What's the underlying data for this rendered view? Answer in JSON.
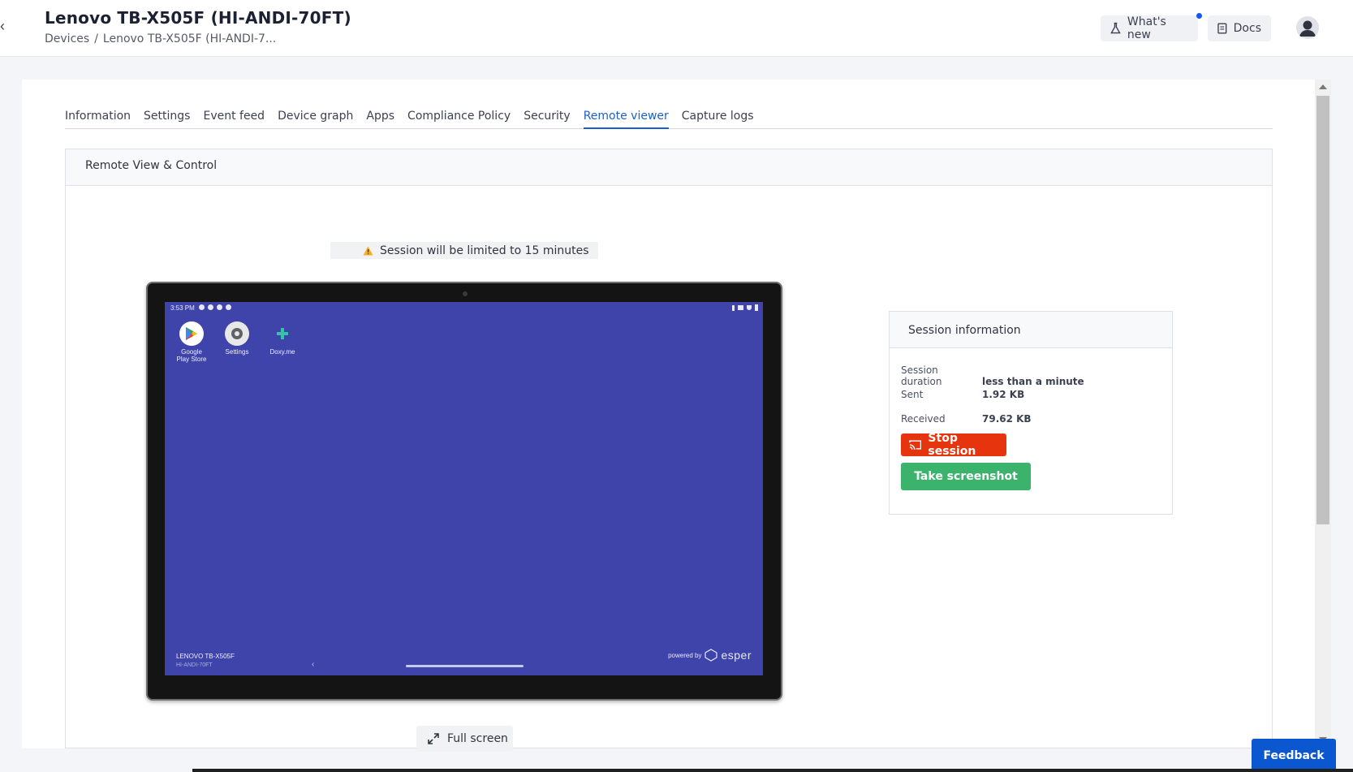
{
  "header": {
    "title": "Lenovo TB-X505F (HI-ANDI-70FT)",
    "breadcrumb": {
      "root": "Devices",
      "separator": "/",
      "current": "Lenovo TB-X505F (HI-ANDI-7..."
    },
    "whats_new_label": "What's new",
    "docs_label": "Docs"
  },
  "tabs": [
    "Information",
    "Settings",
    "Event feed",
    "Device graph",
    "Apps",
    "Compliance Policy",
    "Security",
    "Remote viewer",
    "Capture logs"
  ],
  "active_tab": "Remote viewer",
  "panel": {
    "title": "Remote View & Control",
    "warning": "Session will be limited to 15 minutes",
    "fullscreen_label": "Full screen"
  },
  "device_screen": {
    "status_time": "3:53 PM",
    "apps": [
      {
        "label_line1": "Google",
        "label_line2": "Play Store",
        "icon": "play-store-icon"
      },
      {
        "label_line1": "Settings",
        "label_line2": "",
        "icon": "settings-gear-icon"
      },
      {
        "label_line1": "Doxy.me",
        "label_line2": "",
        "icon": "doxy-me-icon"
      }
    ],
    "device_model": "LENOVO TB-X505F",
    "device_alias": "HI-ANDI-70FT",
    "powered_by": "powered by",
    "brand": "esper",
    "wallpaper_color": "#3e44a9"
  },
  "session": {
    "title": "Session information",
    "duration_label": "Session duration",
    "duration_value": "less than a minute",
    "sent_label": "Sent",
    "sent_value": "1.92 KB",
    "received_label": "Received",
    "received_value": "79.62 KB",
    "stop_label": "Stop session",
    "screenshot_label": "Take screenshot"
  },
  "feedback_label": "Feedback",
  "colors": {
    "accent": "#1a5fd0",
    "stop": "#e6350e",
    "screenshot": "#3bb36d",
    "feedback": "#0b57d0"
  }
}
